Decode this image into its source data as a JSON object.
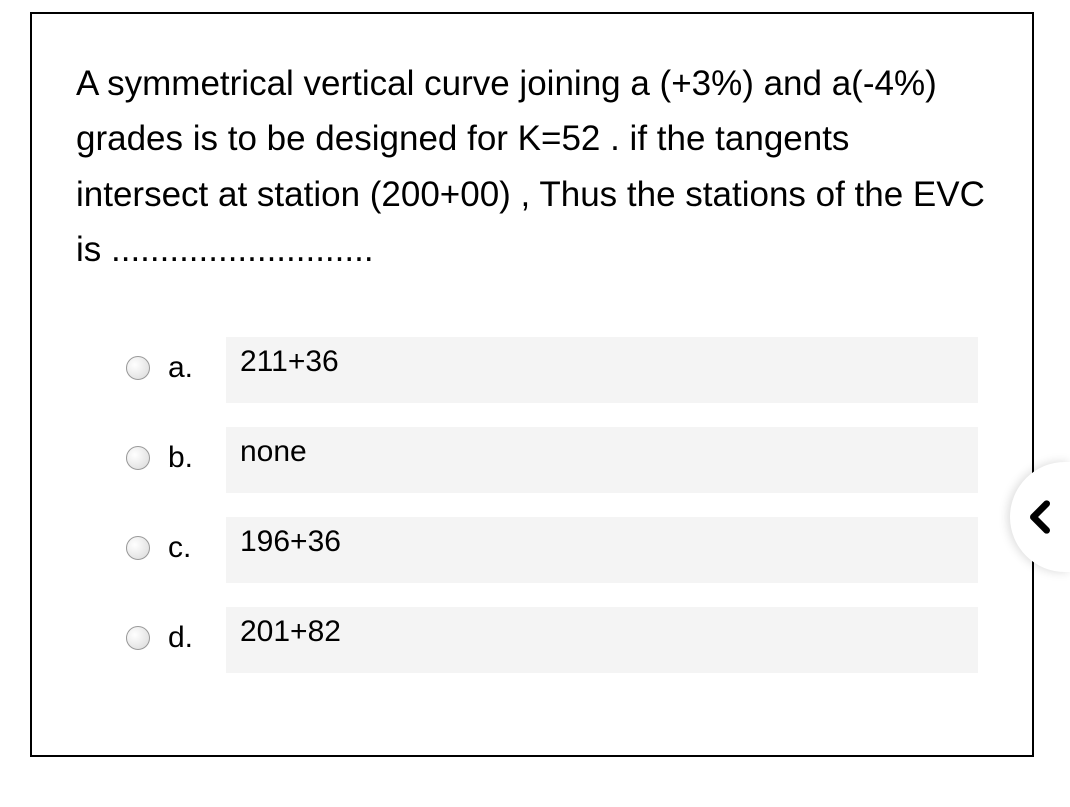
{
  "question": {
    "text": "A symmetrical vertical curve joining a (+3%) and a(-4%) grades is to be designed for K=52 . if the tangents intersect at station (200+00) , Thus the stations of the  EVC is ..........................."
  },
  "options": [
    {
      "letter": "a.",
      "text": "211+36"
    },
    {
      "letter": "b.",
      "text": "none"
    },
    {
      "letter": "c.",
      "text": "196+36"
    },
    {
      "letter": "d.",
      "text": "201+82"
    }
  ]
}
